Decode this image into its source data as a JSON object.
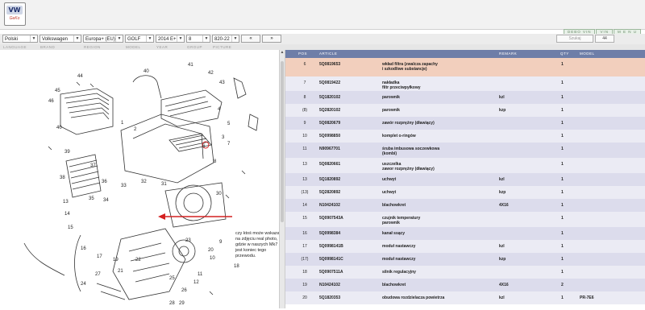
{
  "logo": {
    "brand": "VW",
    "tag": "GeKo"
  },
  "mode_buttons": [
    "DEBO VIN",
    "VIN",
    "M E N U"
  ],
  "selectors": {
    "language": "Polski",
    "brand": "Volkswagen",
    "region": "Europa+ (EU)",
    "model": "GOLF",
    "year": "2014",
    "year_suffix": "E+",
    "group": "8",
    "picture": "820-22"
  },
  "nav": {
    "prev": "«",
    "next": "»"
  },
  "search": {
    "placeholder": "Szukaj",
    "value": "44"
  },
  "labels": [
    "LANGUAGE",
    "BRAND",
    "REGION",
    "MODEL",
    "YEAR",
    "GROUP",
    "PICTURE"
  ],
  "table": {
    "headers": {
      "pos": "POS",
      "article": "ARTICLE",
      "desc": "",
      "remark": "REMARK",
      "qty": "QTY",
      "model": "MODEL"
    },
    "rows": [
      {
        "pos": "6",
        "article": "5Q0819653",
        "desc1": "wkład filtra (zwalcza zapachy",
        "desc2": "i szkodliwe substancje)",
        "remark": "",
        "qty": "1",
        "model": ""
      },
      {
        "pos": "7",
        "article": "5Q0819422",
        "desc1": "nakładka",
        "desc2": "filtr przeciwpyłkowy",
        "remark": "",
        "qty": "1",
        "model": ""
      },
      {
        "pos": "8",
        "article": "5Q1820102",
        "desc1": "parownik",
        "desc2": "",
        "remark": "kzl",
        "qty": "1",
        "model": ""
      },
      {
        "pos": "(8)",
        "article": "5Q2820102",
        "desc1": "parownik",
        "desc2": "",
        "remark": "kzp",
        "qty": "1",
        "model": ""
      },
      {
        "pos": "9",
        "article": "5Q0820679",
        "desc1": "zawór rozprężny (dławiący)",
        "desc2": "",
        "remark": "",
        "qty": "1",
        "model": ""
      },
      {
        "pos": "10",
        "article": "5Q0998850",
        "desc1": "komplet o-ringów",
        "desc2": "",
        "remark": "",
        "qty": "1",
        "model": ""
      },
      {
        "pos": "11",
        "article": "N90967701",
        "desc1": "śruba imbusowa soczewkowa",
        "desc2": "(kombi)",
        "remark": "",
        "qty": "1",
        "model": ""
      },
      {
        "pos": "13",
        "article": "5Q0820661",
        "desc1": "uszczelka",
        "desc2": "zawor rozprężny (dławiący)",
        "remark": "",
        "qty": "1",
        "model": ""
      },
      {
        "pos": "13",
        "article": "5Q1820892",
        "desc1": "uchwyt",
        "desc2": "",
        "remark": "kzl",
        "qty": "1",
        "model": ""
      },
      {
        "pos": "(13)",
        "article": "5Q2820892",
        "desc1": "uchwyt",
        "desc2": "",
        "remark": "kzp",
        "qty": "1",
        "model": ""
      },
      {
        "pos": "14",
        "article": "N10424102",
        "desc1": "blachowkret",
        "desc2": "",
        "remark": "4X16",
        "qty": "1",
        "model": ""
      },
      {
        "pos": "15",
        "article": "5Q0907543A",
        "desc1": "czujnik temperatury",
        "desc2": "parownik",
        "remark": "",
        "qty": "1",
        "model": ""
      },
      {
        "pos": "16",
        "article": "5Q0998384",
        "desc1": "kanał ssący",
        "desc2": "",
        "remark": "",
        "qty": "1",
        "model": ""
      },
      {
        "pos": "17",
        "article": "5Q0998141B",
        "desc1": "moduł nastawczy",
        "desc2": "",
        "remark": "kzl",
        "qty": "1",
        "model": ""
      },
      {
        "pos": "(17)",
        "article": "5Q0998141C",
        "desc1": "moduł nastawczy",
        "desc2": "",
        "remark": "kzp",
        "qty": "1",
        "model": ""
      },
      {
        "pos": "18",
        "article": "5Q0907511A",
        "desc1": "silnik regulacyjny",
        "desc2": "",
        "remark": "",
        "qty": "1",
        "model": ""
      },
      {
        "pos": "19",
        "article": "N10424102",
        "desc1": "blachowkret",
        "desc2": "",
        "remark": "4X16",
        "qty": "2",
        "model": ""
      },
      {
        "pos": "20",
        "article": "5Q1820353",
        "desc1": "obudowa rozdzielacza powietrza",
        "desc2": "",
        "remark": "kzl",
        "qty": "1",
        "model": "PR-7E6"
      }
    ]
  },
  "annotation": "czy ktoś może wskazać na zdjęciu real photo, gdzie w naszych Mk7 jest koniec tego przewodu.",
  "callouts": [
    "1",
    "2",
    "3",
    "4",
    "5",
    "6",
    "7",
    "8",
    "9",
    "10",
    "11",
    "12",
    "13",
    "14",
    "15",
    "16",
    "17",
    "18",
    "19",
    "20",
    "21",
    "22",
    "23",
    "24",
    "25",
    "26",
    "27",
    "28",
    "29",
    "30",
    "31",
    "32",
    "33",
    "34",
    "35",
    "36",
    "37",
    "38",
    "39",
    "40",
    "41",
    "42",
    "43",
    "44",
    "45"
  ],
  "colors": {
    "header": "#6e7ea8",
    "row_a": "#ebebf4",
    "row_b": "#dcdcec",
    "selected": "#f2cfbd",
    "arrow": "#d42020"
  }
}
